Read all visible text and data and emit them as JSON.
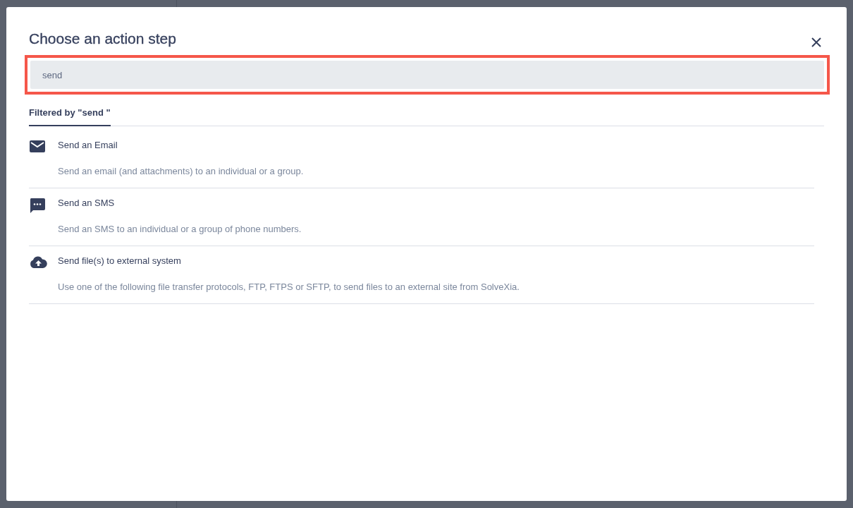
{
  "dialog": {
    "title": "Choose an action step"
  },
  "search": {
    "value": "send",
    "highlighted": true
  },
  "tabs": [
    {
      "label": "Filtered by \"send \"",
      "selected": true
    }
  ],
  "actions": [
    {
      "kind": "email",
      "title": "Send an Email",
      "description": "Send an email (and attachments) to an individual or a group."
    },
    {
      "kind": "sms",
      "title": "Send an SMS",
      "description": "Send an SMS to an individual or a group of phone numbers."
    },
    {
      "kind": "upload",
      "title": "Send file(s) to external system",
      "description": "Use one of the following file transfer protocols, FTP, FTPS or SFTP, to send files to an external site from SolveXia."
    }
  ]
}
